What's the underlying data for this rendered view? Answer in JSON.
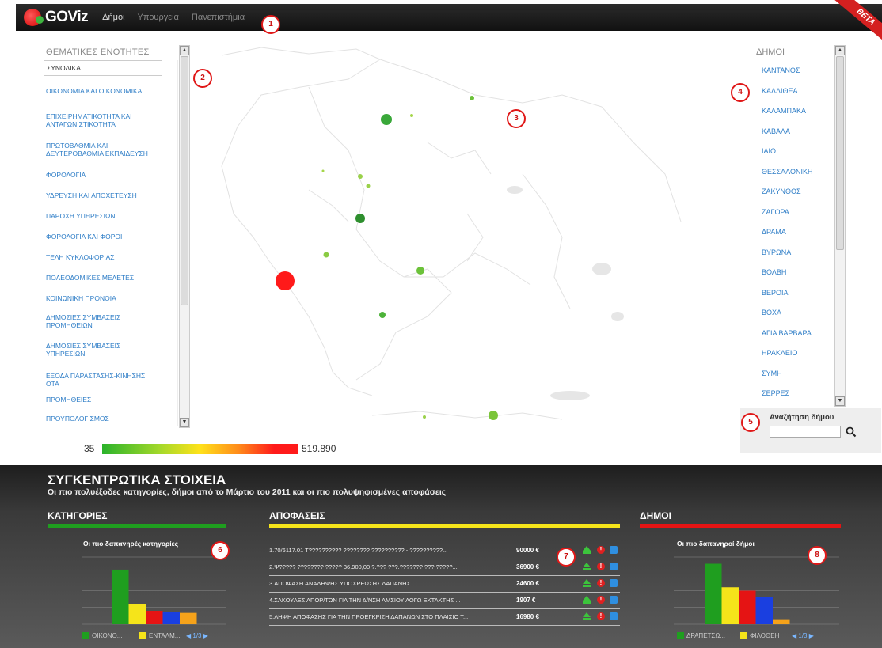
{
  "header": {
    "logo_text": "GOViz",
    "nav": [
      "Δήμοι",
      "Υπουργεία",
      "Πανεπιστήμια"
    ],
    "beta": "BETA"
  },
  "left_panel": {
    "title": "ΘΕΜΑΤΙΚΕΣ ΕΝΟΤΗΤΕΣ",
    "items": [
      "ΣΥΝΟΛΙΚΑ",
      "ΟΙΚΟΝΟΜΙΑ ΚΑΙ ΟΙΚΟΝΟΜΙΚΑ",
      "ΕΠΙΧΕΙΡΗΜΑΤΙΚΟΤΗΤΑ ΚΑΙ ΑΝΤΑΓΩΝΙΣΤΙΚΟΤΗΤΑ",
      "ΠΡΩΤΟΒΑΘΜΙΑ ΚΑΙ ΔΕΥΤΕΡΟΒΑΘΜΙΑ ΕΚΠΑΙΔΕΥΣΗ",
      "ΦΟΡΟΛΟΓΙΑ",
      "ΥΔΡΕΥΣΗ ΚΑΙ ΑΠΟΧΕΤΕΥΣΗ",
      "ΠΑΡΟΧΗ ΥΠΗΡΕΣΙΩΝ",
      "ΦΟΡΟΛΟΓΙΑ ΚΑΙ ΦΟΡΟΙ",
      "ΤΕΛΗ ΚΥΚΛΟΦΟΡΙΑΣ",
      "ΠΟΛΕΟΔΟΜΙΚΕΣ ΜΕΛΕΤΕΣ",
      "ΚΟΙΝΩΝΙΚΗ ΠΡΟΝΟΙΑ",
      "ΔΗΜΟΣΙΕΣ ΣΥΜΒΑΣΕΙΣ ΠΡΟΜΗΘΕΙΩΝ",
      "ΔΗΜΟΣΙΕΣ ΣΥΜΒΑΣΕΙΣ ΥΠΗΡΕΣΙΩΝ",
      "ΕΞΟΔΑ ΠΑΡΑΣΤΑΣΗΣ-ΚΙΝΗΣΗΣ ΟΤΑ",
      "ΠΡΟΜΗΘΕΙΕΣ",
      "ΠΡΟΥΠΟΛΟΓΙΣΜΟΣ"
    ]
  },
  "right_panel": {
    "title": "ΔΗΜΟΙ",
    "items": [
      "ΚΑΝΤΑΝΟΣ",
      "ΚΑΛΛΙΘΕΑ",
      "ΚΑΛΑΜΠΑΚΑ",
      "ΚΑΒΑΛΑ",
      "ΙΑΙΟ",
      "ΘΕΣΣΑΛΟΝΙΚΗ",
      "ΖΑΚΥΝΘΟΣ",
      "ΖΑΓΟΡΑ",
      "ΔΡΑΜΑ",
      "ΒΥΡΩΝΑ",
      "ΒΟΛΒΗ",
      "ΒΕΡΟΙΑ",
      "ΒΟΧΑ",
      "ΑΓΙΑ ΒΑΡΒΑΡΑ",
      "ΗΡΑΚΛΕΙΟ",
      "ΣΥΜΗ",
      "ΣΕΡΡΕΣ"
    ],
    "search_label": "Αναζήτηση δήμου",
    "search_value": ""
  },
  "legend": {
    "min": "35",
    "max": "519.890"
  },
  "markers": [
    "1",
    "2",
    "3",
    "4",
    "5",
    "6",
    "7",
    "8"
  ],
  "summary": {
    "title": "ΣΥΓΚΕΝΤΡΩΤΙΚΑ ΣΤΟΙΧΕΙΑ",
    "subtitle": "Οι πιο πολυέξοδες κατηγορίες, δήμοι από το Μάρτιο του 2011 και οι πιο πολυψηφισμένες αποφάσεις"
  },
  "categories_section": {
    "title": "ΚΑΤΗΓΟΡΙΕΣ",
    "chart_title": "Οι πιο δαπανηρές κατηγορίες",
    "legend": [
      "ΟΙΚΟΝΟ...",
      "ΕΝΤΑΛΜ..."
    ],
    "pager": "1/3"
  },
  "decisions_section": {
    "title": "ΑΠΟΦΑΣΕΙΣ",
    "rows": [
      {
        "text": "1.70/6117.01 Τ?????????? ???????? ?????????? - ??????????...",
        "amount": "90000 €"
      },
      {
        "text": "2.Ψ????? ???????? ????? 36.900,00 ?.??? ???.??????? ???.?????...",
        "amount": "36900 €"
      },
      {
        "text": "3.ΑΠΟΦΑΣΗ ΑΝΑΛΗΨΗΣ ΥΠΟΧΡΕΩΣΗΣ ΔΑΠΑΝΗΣ",
        "amount": "24600 €"
      },
      {
        "text": "4.ΣΑΚΟΥΛΕΣ ΑΠΟΡ/ΤΩΝ ΓΙΑ ΤΗΝ Δ/ΝΣΗ ΑΜΣΙΟΥ ΛΟΓΩ ΕΚΤΑΚΤΗΣ ...",
        "amount": "1907 €"
      },
      {
        "text": "5.ΛΗΨΗ ΑΠΟΦΑΣΗΣ ΓΙΑ ΤΗΝ ΠΡΟΕΓΚΡΙΣΗ ΔΑΠΑΝΩΝ ΣΤΟ ΠΛΑΙΣΙΟ Τ...",
        "amount": "16980 €"
      }
    ]
  },
  "municipalities_section": {
    "title": "ΔΗΜΟΙ",
    "chart_title": "Οι πιο δαπανηροί δήμοι",
    "legend": [
      "ΔΡΑΠΕΤΣΩ...",
      "ΦΙΛΟΘΕΗ"
    ],
    "pager": "1/3"
  },
  "colors": {
    "green": "#1f9e1f",
    "yellow": "#f5e41a",
    "red": "#e51414",
    "blue": "#1a3fe0",
    "orange": "#f5a21a"
  },
  "chart_data": [
    {
      "type": "bar",
      "title": "Οι πιο δαπανηρές κατηγορίες",
      "values": [
        1300000,
        480000,
        320000,
        300000,
        270000
      ],
      "colors": [
        "#1f9e1f",
        "#f5e41a",
        "#e51414",
        "#1a3fe0",
        "#f5a21a"
      ],
      "ylim": [
        0,
        1600000
      ]
    },
    {
      "type": "bar",
      "title": "Οι πιο δαπανηροί δήμοι",
      "values": [
        86000,
        72000,
        70000,
        66000,
        53000
      ],
      "colors": [
        "#1f9e1f",
        "#f5e41a",
        "#e51414",
        "#1a3fe0",
        "#f5a21a"
      ],
      "ylim": [
        50000,
        90000
      ]
    }
  ]
}
